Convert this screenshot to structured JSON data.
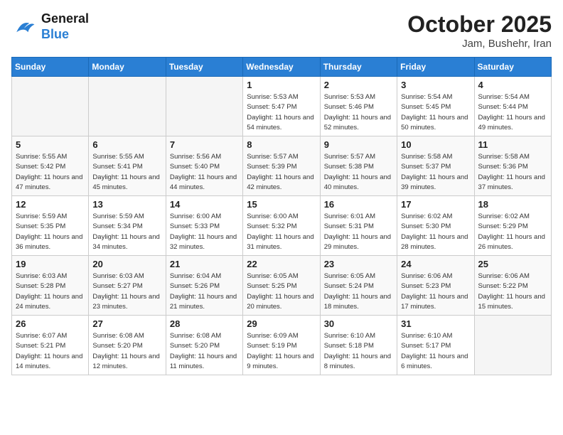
{
  "header": {
    "logo_line1": "General",
    "logo_line2": "Blue",
    "month": "October 2025",
    "location": "Jam, Bushehr, Iran"
  },
  "weekdays": [
    "Sunday",
    "Monday",
    "Tuesday",
    "Wednesday",
    "Thursday",
    "Friday",
    "Saturday"
  ],
  "weeks": [
    [
      {
        "day": "",
        "sunrise": "",
        "sunset": "",
        "daylight": ""
      },
      {
        "day": "",
        "sunrise": "",
        "sunset": "",
        "daylight": ""
      },
      {
        "day": "",
        "sunrise": "",
        "sunset": "",
        "daylight": ""
      },
      {
        "day": "1",
        "sunrise": "Sunrise: 5:53 AM",
        "sunset": "Sunset: 5:47 PM",
        "daylight": "Daylight: 11 hours and 54 minutes."
      },
      {
        "day": "2",
        "sunrise": "Sunrise: 5:53 AM",
        "sunset": "Sunset: 5:46 PM",
        "daylight": "Daylight: 11 hours and 52 minutes."
      },
      {
        "day": "3",
        "sunrise": "Sunrise: 5:54 AM",
        "sunset": "Sunset: 5:45 PM",
        "daylight": "Daylight: 11 hours and 50 minutes."
      },
      {
        "day": "4",
        "sunrise": "Sunrise: 5:54 AM",
        "sunset": "Sunset: 5:44 PM",
        "daylight": "Daylight: 11 hours and 49 minutes."
      }
    ],
    [
      {
        "day": "5",
        "sunrise": "Sunrise: 5:55 AM",
        "sunset": "Sunset: 5:42 PM",
        "daylight": "Daylight: 11 hours and 47 minutes."
      },
      {
        "day": "6",
        "sunrise": "Sunrise: 5:55 AM",
        "sunset": "Sunset: 5:41 PM",
        "daylight": "Daylight: 11 hours and 45 minutes."
      },
      {
        "day": "7",
        "sunrise": "Sunrise: 5:56 AM",
        "sunset": "Sunset: 5:40 PM",
        "daylight": "Daylight: 11 hours and 44 minutes."
      },
      {
        "day": "8",
        "sunrise": "Sunrise: 5:57 AM",
        "sunset": "Sunset: 5:39 PM",
        "daylight": "Daylight: 11 hours and 42 minutes."
      },
      {
        "day": "9",
        "sunrise": "Sunrise: 5:57 AM",
        "sunset": "Sunset: 5:38 PM",
        "daylight": "Daylight: 11 hours and 40 minutes."
      },
      {
        "day": "10",
        "sunrise": "Sunrise: 5:58 AM",
        "sunset": "Sunset: 5:37 PM",
        "daylight": "Daylight: 11 hours and 39 minutes."
      },
      {
        "day": "11",
        "sunrise": "Sunrise: 5:58 AM",
        "sunset": "Sunset: 5:36 PM",
        "daylight": "Daylight: 11 hours and 37 minutes."
      }
    ],
    [
      {
        "day": "12",
        "sunrise": "Sunrise: 5:59 AM",
        "sunset": "Sunset: 5:35 PM",
        "daylight": "Daylight: 11 hours and 36 minutes."
      },
      {
        "day": "13",
        "sunrise": "Sunrise: 5:59 AM",
        "sunset": "Sunset: 5:34 PM",
        "daylight": "Daylight: 11 hours and 34 minutes."
      },
      {
        "day": "14",
        "sunrise": "Sunrise: 6:00 AM",
        "sunset": "Sunset: 5:33 PM",
        "daylight": "Daylight: 11 hours and 32 minutes."
      },
      {
        "day": "15",
        "sunrise": "Sunrise: 6:00 AM",
        "sunset": "Sunset: 5:32 PM",
        "daylight": "Daylight: 11 hours and 31 minutes."
      },
      {
        "day": "16",
        "sunrise": "Sunrise: 6:01 AM",
        "sunset": "Sunset: 5:31 PM",
        "daylight": "Daylight: 11 hours and 29 minutes."
      },
      {
        "day": "17",
        "sunrise": "Sunrise: 6:02 AM",
        "sunset": "Sunset: 5:30 PM",
        "daylight": "Daylight: 11 hours and 28 minutes."
      },
      {
        "day": "18",
        "sunrise": "Sunrise: 6:02 AM",
        "sunset": "Sunset: 5:29 PM",
        "daylight": "Daylight: 11 hours and 26 minutes."
      }
    ],
    [
      {
        "day": "19",
        "sunrise": "Sunrise: 6:03 AM",
        "sunset": "Sunset: 5:28 PM",
        "daylight": "Daylight: 11 hours and 24 minutes."
      },
      {
        "day": "20",
        "sunrise": "Sunrise: 6:03 AM",
        "sunset": "Sunset: 5:27 PM",
        "daylight": "Daylight: 11 hours and 23 minutes."
      },
      {
        "day": "21",
        "sunrise": "Sunrise: 6:04 AM",
        "sunset": "Sunset: 5:26 PM",
        "daylight": "Daylight: 11 hours and 21 minutes."
      },
      {
        "day": "22",
        "sunrise": "Sunrise: 6:05 AM",
        "sunset": "Sunset: 5:25 PM",
        "daylight": "Daylight: 11 hours and 20 minutes."
      },
      {
        "day": "23",
        "sunrise": "Sunrise: 6:05 AM",
        "sunset": "Sunset: 5:24 PM",
        "daylight": "Daylight: 11 hours and 18 minutes."
      },
      {
        "day": "24",
        "sunrise": "Sunrise: 6:06 AM",
        "sunset": "Sunset: 5:23 PM",
        "daylight": "Daylight: 11 hours and 17 minutes."
      },
      {
        "day": "25",
        "sunrise": "Sunrise: 6:06 AM",
        "sunset": "Sunset: 5:22 PM",
        "daylight": "Daylight: 11 hours and 15 minutes."
      }
    ],
    [
      {
        "day": "26",
        "sunrise": "Sunrise: 6:07 AM",
        "sunset": "Sunset: 5:21 PM",
        "daylight": "Daylight: 11 hours and 14 minutes."
      },
      {
        "day": "27",
        "sunrise": "Sunrise: 6:08 AM",
        "sunset": "Sunset: 5:20 PM",
        "daylight": "Daylight: 11 hours and 12 minutes."
      },
      {
        "day": "28",
        "sunrise": "Sunrise: 6:08 AM",
        "sunset": "Sunset: 5:20 PM",
        "daylight": "Daylight: 11 hours and 11 minutes."
      },
      {
        "day": "29",
        "sunrise": "Sunrise: 6:09 AM",
        "sunset": "Sunset: 5:19 PM",
        "daylight": "Daylight: 11 hours and 9 minutes."
      },
      {
        "day": "30",
        "sunrise": "Sunrise: 6:10 AM",
        "sunset": "Sunset: 5:18 PM",
        "daylight": "Daylight: 11 hours and 8 minutes."
      },
      {
        "day": "31",
        "sunrise": "Sunrise: 6:10 AM",
        "sunset": "Sunset: 5:17 PM",
        "daylight": "Daylight: 11 hours and 6 minutes."
      },
      {
        "day": "",
        "sunrise": "",
        "sunset": "",
        "daylight": ""
      }
    ]
  ]
}
